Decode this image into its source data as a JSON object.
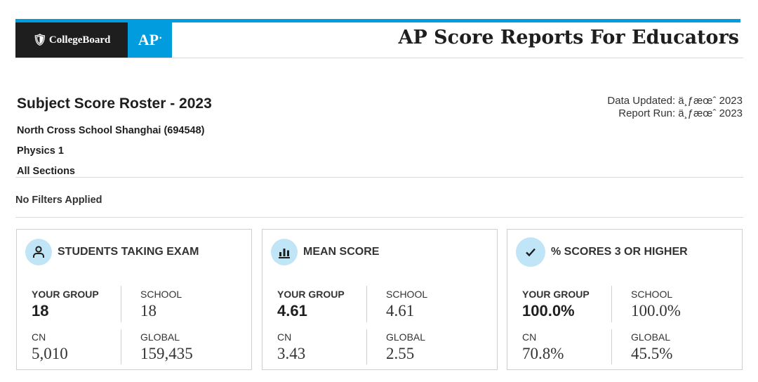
{
  "header": {
    "brand": "CollegeBoard",
    "ap_logo": "AP",
    "title": "AP Score Reports For Educators"
  },
  "report": {
    "title": "Subject Score Roster - 2023",
    "data_updated": "Data Updated: ä¸ƒæœˆ 2023",
    "report_run": "Report Run: ä¸ƒæœˆ 2023",
    "school": "North Cross School Shanghai (694548)",
    "subject": "Physics 1",
    "sections": "All Sections",
    "filters": "No Filters Applied"
  },
  "cards": [
    {
      "title": "STUDENTS TAKING EXAM",
      "icon": "person-icon",
      "your_group_label": "YOUR GROUP",
      "your_group_value": "18",
      "school_label": "SCHOOL",
      "school_value": "18",
      "cn_label": "CN",
      "cn_value": "5,010",
      "global_label": "GLOBAL",
      "global_value": "159,435"
    },
    {
      "title": "MEAN SCORE",
      "icon": "bar-chart-icon",
      "your_group_label": "YOUR GROUP",
      "your_group_value": "4.61",
      "school_label": "SCHOOL",
      "school_value": "4.61",
      "cn_label": "CN",
      "cn_value": "3.43",
      "global_label": "GLOBAL",
      "global_value": "2.55"
    },
    {
      "title": "% SCORES 3 OR HIGHER",
      "icon": "checkmark-icon",
      "your_group_label": "YOUR GROUP",
      "your_group_value": "100.0%",
      "school_label": "SCHOOL",
      "school_value": "100.0%",
      "cn_label": "CN",
      "cn_value": "70.8%",
      "global_label": "GLOBAL",
      "global_value": "45.5%"
    }
  ],
  "colors": {
    "accent": "#009cde",
    "icon_bg": "#bfe5f6",
    "dark": "#1e1e1e"
  }
}
